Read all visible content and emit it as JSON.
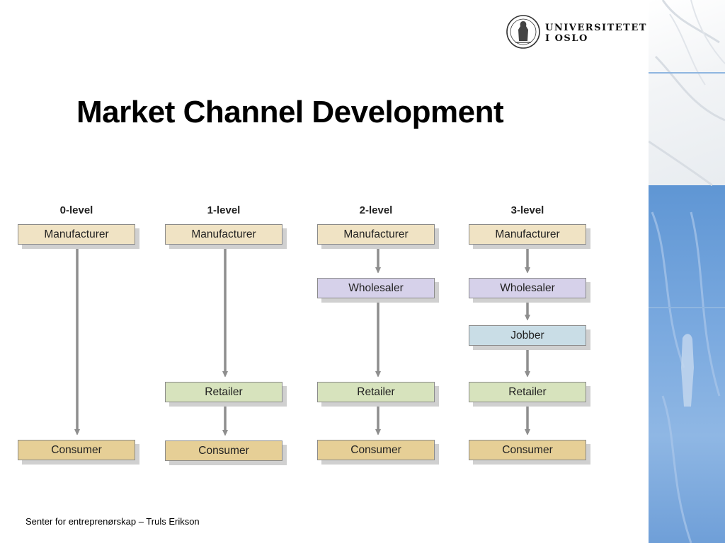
{
  "slide": {
    "title": "Market Channel Development",
    "footer": "Senter for entreprenørskap – Truls Erikson"
  },
  "logo": {
    "line1": "UNIVERSITETET",
    "line2": "I OSLO",
    "icon": "university-seal-icon"
  },
  "diagram": {
    "levels": [
      {
        "label": "0-level",
        "nodes": [
          "Manufacturer",
          "Consumer"
        ]
      },
      {
        "label": "1-level",
        "nodes": [
          "Manufacturer",
          "Retailer",
          "Consumer"
        ]
      },
      {
        "label": "2-level",
        "nodes": [
          "Manufacturer",
          "Wholesaler",
          "Retailer",
          "Consumer"
        ]
      },
      {
        "label": "3-level",
        "nodes": [
          "Manufacturer",
          "Wholesaler",
          "Jobber",
          "Retailer",
          "Consumer"
        ]
      }
    ]
  },
  "colors": {
    "manufacturer": "#f0e3c4",
    "wholesaler": "#d6d1ea",
    "jobber": "#c9dde6",
    "retailer": "#d7e3bd",
    "consumer": "#e6cf96",
    "arrow": "#8e8e8e",
    "side_panel": "#6f9fd8"
  }
}
